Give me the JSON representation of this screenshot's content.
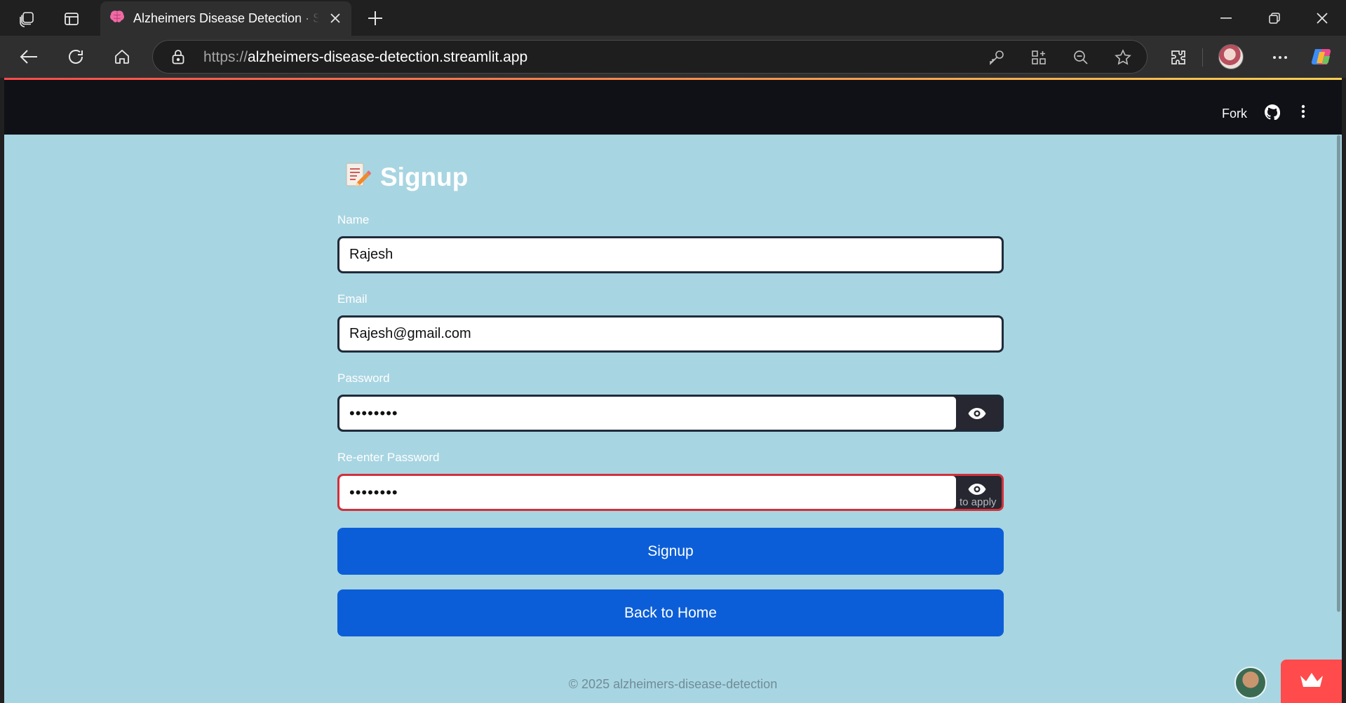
{
  "browser": {
    "tab_title": "Alzheimers Disease Detection · Streamlit",
    "url_scheme": "https://",
    "url_host": "alzheimers-disease-detection.streamlit.app",
    "icons": [
      "workspaces-icon",
      "tab-actions-icon",
      "brain-favicon-icon",
      "close-tab-icon",
      "new-tab-icon",
      "minimize-icon",
      "restore-icon",
      "close-window-icon",
      "back-icon",
      "refresh-icon",
      "home-icon",
      "site-info-lock-icon",
      "key-icon",
      "app-available-icon",
      "zoom-out-icon",
      "favorite-star-icon",
      "extensions-icon",
      "profile-avatar",
      "more-icon",
      "copilot-icon"
    ]
  },
  "header": {
    "fork_label": "Fork",
    "icons": [
      "github-icon",
      "kebab-menu-icon"
    ],
    "accent_gradient": [
      "#ff4b4b",
      "#fdd14f"
    ],
    "background": "#0f1116"
  },
  "page": {
    "background": "#a8d5e2",
    "title_icon": "memo-pencil-icon",
    "title": "Signup",
    "fields": {
      "name": {
        "label": "Name",
        "value": "Rajesh"
      },
      "email": {
        "label": "Email",
        "value": "Rajesh@gmail.com"
      },
      "password": {
        "label": "Password",
        "value": "••••••••"
      },
      "reenter": {
        "label": "Re-enter Password",
        "value": "••••••••",
        "hint": "to apply"
      }
    },
    "buttons": {
      "signup": "Signup",
      "back_home": "Back to Home",
      "color": "#0b5ed7"
    },
    "footer": "© 2025 alzheimers-disease-detection"
  }
}
